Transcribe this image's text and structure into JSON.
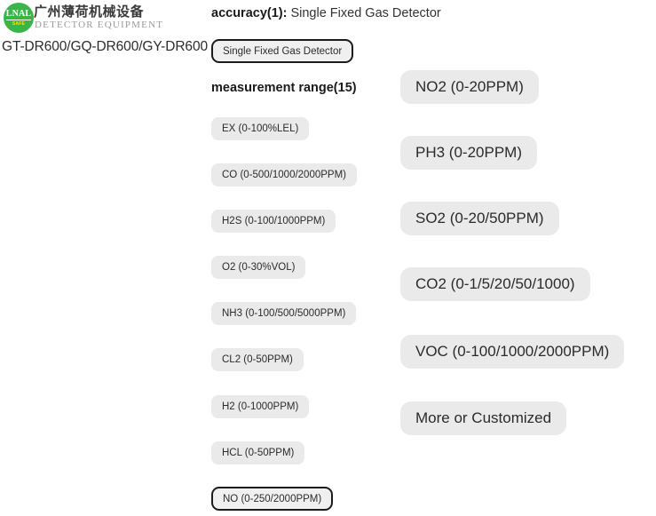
{
  "brand": {
    "logo_text": "LNAL",
    "logo_badge": "SAFE",
    "name_cn": "广州薄荷机械设备",
    "name_en": "DETECTOR  EQUIPMENT",
    "logo_color": "#3ab54a",
    "badge_color": "#ffe400"
  },
  "product": {
    "model": "GT-DR600/GQ-DR600/GY-DR600"
  },
  "options": {
    "accuracy": {
      "label": "accuracy(1):",
      "value": "Single Fixed Gas Detector",
      "chips": [
        {
          "label": "Single Fixed Gas Detector",
          "selected": true
        }
      ]
    },
    "measurement_range": {
      "label": "measurement range(15)",
      "count": 15,
      "chips_left": [
        {
          "label": "EX (0-100%LEL)",
          "selected": false
        },
        {
          "label": "CO (0-500/1000/2000PPM)",
          "selected": false
        },
        {
          "label": "H2S (0-100/1000PPM)",
          "selected": false
        },
        {
          "label": "O2 (0-30%VOL)",
          "selected": false
        },
        {
          "label": "NH3 (0-100/500/5000PPM)",
          "selected": false
        },
        {
          "label": "CL2 (0-50PPM)",
          "selected": false
        },
        {
          "label": "H2 (0-1000PPM)",
          "selected": false
        },
        {
          "label": "HCL (0-50PPM)",
          "selected": false
        },
        {
          "label": "NO (0-250/2000PPM)",
          "selected": true
        }
      ],
      "chips_right": [
        {
          "label": "NO2 (0-20PPM)",
          "selected": false
        },
        {
          "label": "PH3 (0-20PPM)",
          "selected": false
        },
        {
          "label": "SO2 (0-20/50PPM)",
          "selected": false
        },
        {
          "label": "CO2 (0-1/5/20/50/1000)",
          "selected": false
        },
        {
          "label": "VOC (0-100/1000/2000PPM)",
          "selected": false
        },
        {
          "label": "More or Customized",
          "selected": false
        }
      ]
    }
  },
  "colors": {
    "chip_background": "#eaeaea",
    "chip_selected_border": "#1c1c1c",
    "text": "#2b2b2b"
  }
}
